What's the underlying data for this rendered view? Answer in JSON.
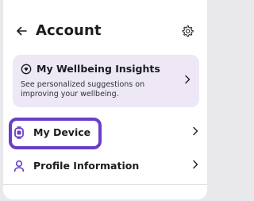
{
  "header": {
    "title": "Account",
    "back_icon": "arrow-left-icon",
    "settings_icon": "gear-icon"
  },
  "insights": {
    "title": "My Wellbeing Insights",
    "description": "See personalized suggestions on improving your wellbeing.",
    "icon": "wellbeing-icon",
    "chevron": ">"
  },
  "menu": {
    "items": [
      {
        "label": "My Device",
        "icon": "watch-icon",
        "chevron": ">"
      },
      {
        "label": "Profile Information",
        "icon": "person-icon",
        "chevron": ">"
      }
    ]
  },
  "colors": {
    "accent": "#6a3ec7",
    "card_bg": "#ede7f6",
    "text": "#1c1b1f"
  }
}
